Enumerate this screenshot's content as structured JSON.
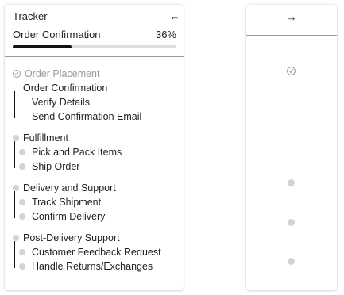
{
  "tracker": {
    "title": "Tracker",
    "collapse_icon": "arrow-left-icon",
    "collapse_glyph": "←",
    "expand_icon": "arrow-right-icon",
    "expand_glyph": "→",
    "current_step": "Order Confirmation",
    "progress_text": "36%",
    "progress_fraction": 0.36
  },
  "stages": [
    {
      "label": "Order Placement",
      "status": "completed",
      "substeps": []
    },
    {
      "label": "Order Confirmation",
      "status": "current",
      "substeps": [
        {
          "label": "Verify Details"
        },
        {
          "label": "Send Confirmation Email"
        }
      ]
    },
    {
      "label": "Fulfillment",
      "status": "pending",
      "substeps": [
        {
          "label": "Pick and Pack Items"
        },
        {
          "label": "Ship Order"
        }
      ]
    },
    {
      "label": "Delivery and Support",
      "status": "pending",
      "substeps": [
        {
          "label": "Track Shipment"
        },
        {
          "label": "Confirm Delivery"
        }
      ]
    },
    {
      "label": "Post-Delivery Support",
      "status": "pending",
      "substeps": [
        {
          "label": "Customer Feedback Request"
        },
        {
          "label": "Handle Returns/Exchanges"
        }
      ]
    }
  ],
  "colors": {
    "rail": "#111111",
    "progress_fill": "#111111",
    "progress_track": "#dddddd",
    "pending_dot": "#d3d3d3",
    "completed_text": "#999999"
  }
}
